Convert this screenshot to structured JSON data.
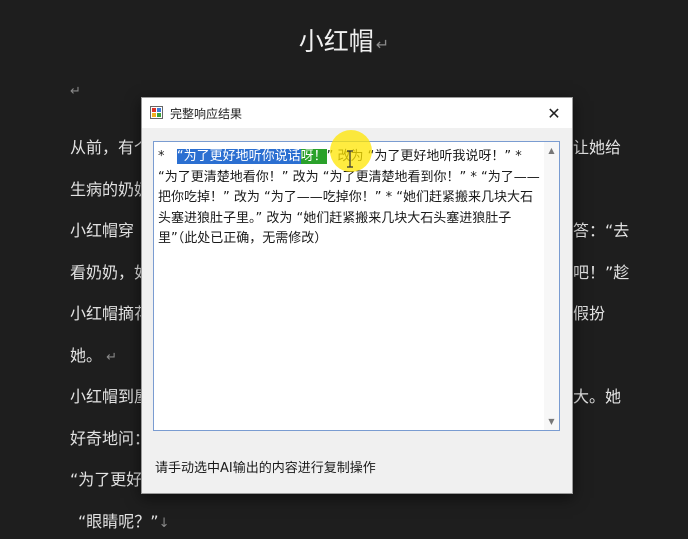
{
  "document": {
    "title": "小红帽",
    "line1_left": "从前，有个",
    "line1_right": "让她给",
    "line2": "生病的奶奶",
    "line3_left": "小红帽穿",
    "line3_right": "答：“去",
    "line4_left": "看奶奶，如",
    "line4_right": "吧！”趁",
    "line5_left": "小红帽摘花",
    "line5_right": "假扮",
    "line6": "她。",
    "line7_left": "小红帽到屋",
    "line7_right": "大。她",
    "line8": "好奇地问：",
    "line9": "“为了更好",
    "line10": "“眼睛呢？”"
  },
  "dialog": {
    "title": "完整响应结果",
    "close_glyph": "✕",
    "status_text": "请手动选中AI输出的内容进行复制操作",
    "content": {
      "star1": "*",
      "selected_blue": "“为了更好地听你说话",
      "selected_green": "呀！",
      "rest": "” 改为 “为了更好地听我说呀！” * “为了更清楚地看你！” 改为 “为了更清楚地看到你！” * “为了——把你吃掉！” 改为 “为了——吃掉你！” * “她们赶紧搬来几块大石头塞进狼肚子里。” 改为 “她们赶紧搬来几块大石头塞进狼肚子里”（此处已正确，无需修改）"
    }
  }
}
